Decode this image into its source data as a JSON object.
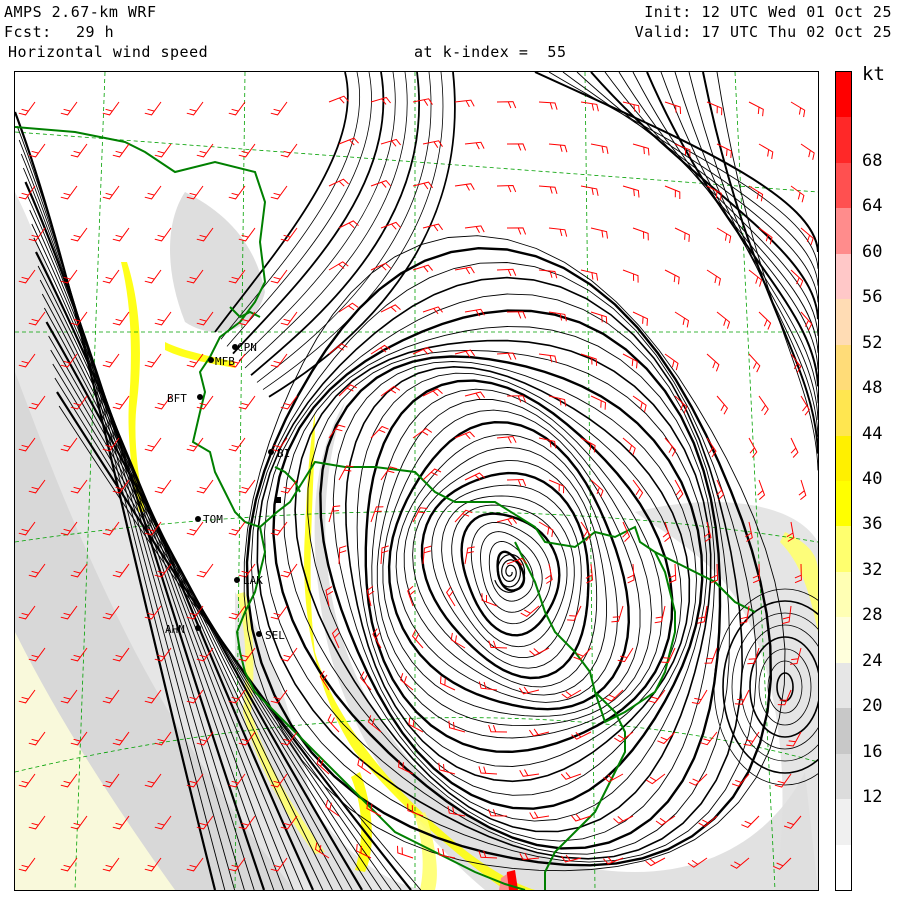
{
  "header": {
    "model": "AMPS 2.67-km WRF",
    "fcst_label": "Fcst:",
    "fcst_value": "29 h",
    "field": "Horizontal wind speed",
    "level": "at k-index =  55",
    "init": "Init: 12 UTC Wed 01 Oct 25",
    "valid": "Valid: 17 UTC Thu 02 Oct 25"
  },
  "colorbar": {
    "unit": "kt",
    "tick_labels": [
      "68",
      "64",
      "60",
      "56",
      "52",
      "48",
      "44",
      "40",
      "36",
      "32",
      "28",
      "24",
      "20",
      "16",
      "12"
    ],
    "levels": [
      {
        "min": 72,
        "color": "#ff0000"
      },
      {
        "min": 68,
        "color": "#ff2828"
      },
      {
        "min": 64,
        "color": "#ff5050"
      },
      {
        "min": 60,
        "color": "#ff8c8c"
      },
      {
        "min": 56,
        "color": "#ffc8c8"
      },
      {
        "min": 52,
        "color": "#ffdcb4"
      },
      {
        "min": 48,
        "color": "#ffdc78"
      },
      {
        "min": 44,
        "color": "#ffe650"
      },
      {
        "min": 40,
        "color": "#fff000"
      },
      {
        "min": 36,
        "color": "#ffff00"
      },
      {
        "min": 32,
        "color": "#ffff6e"
      },
      {
        "min": 28,
        "color": "#ffffb4"
      },
      {
        "min": 24,
        "color": "#ffffdc"
      },
      {
        "min": 20,
        "color": "#e6e6e6"
      },
      {
        "min": 16,
        "color": "#c8c8c8"
      },
      {
        "min": 12,
        "color": "#dcdcdc"
      },
      {
        "min": 8,
        "color": "#f0f0f0"
      },
      {
        "min": 0,
        "color": "#ffffff"
      }
    ]
  },
  "stations": [
    {
      "id": "CPN"
    },
    {
      "id": "MFB"
    },
    {
      "id": "BFT"
    },
    {
      "id": "BI"
    },
    {
      "id": "TOM"
    },
    {
      "id": "LAK"
    },
    {
      "id": "AHN"
    },
    {
      "id": "SEL"
    }
  ],
  "colors": {
    "coastline": "#008000",
    "streamline": "#000000",
    "barb": "#ff0000",
    "grid": "#00a000"
  }
}
